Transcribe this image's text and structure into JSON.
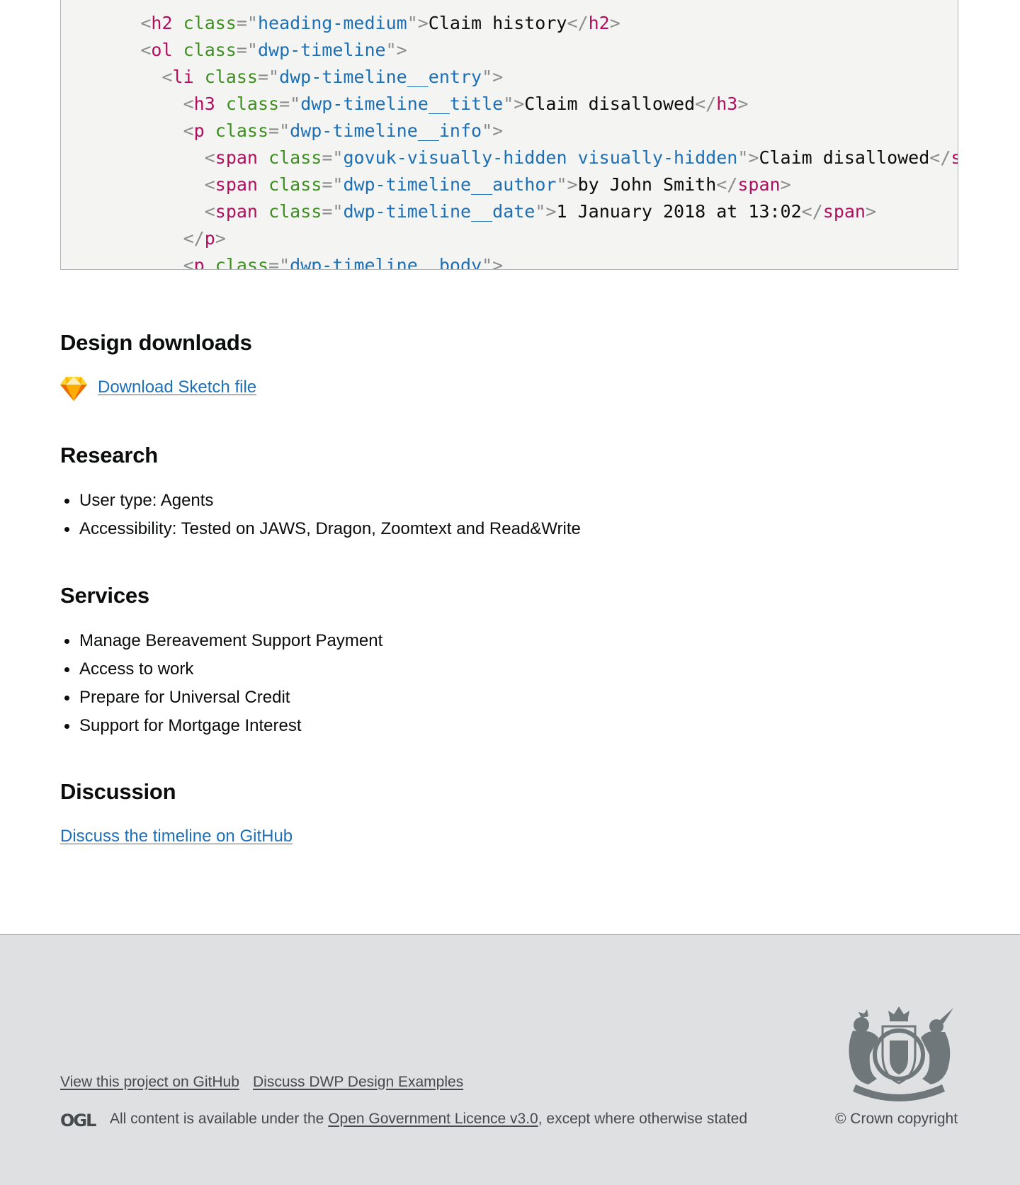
{
  "code_sample": {
    "lines": [
      {
        "indent": "      ",
        "parts": [
          [
            "p",
            "<"
          ],
          [
            "t",
            "h2"
          ],
          [
            "s",
            " "
          ],
          [
            "a",
            "class"
          ],
          [
            "p",
            "=\""
          ],
          [
            "v",
            "heading-medium"
          ],
          [
            "p",
            "\">"
          ],
          [
            "x",
            "Claim history"
          ],
          [
            "p",
            "</"
          ],
          [
            "t",
            "h2"
          ],
          [
            "p",
            ">"
          ]
        ]
      },
      {
        "indent": "      ",
        "parts": [
          [
            "p",
            "<"
          ],
          [
            "t",
            "ol"
          ],
          [
            "s",
            " "
          ],
          [
            "a",
            "class"
          ],
          [
            "p",
            "=\""
          ],
          [
            "v",
            "dwp-timeline"
          ],
          [
            "p",
            "\">"
          ]
        ]
      },
      {
        "indent": "        ",
        "parts": [
          [
            "p",
            "<"
          ],
          [
            "t",
            "li"
          ],
          [
            "s",
            " "
          ],
          [
            "a",
            "class"
          ],
          [
            "p",
            "=\""
          ],
          [
            "v",
            "dwp-timeline__entry"
          ],
          [
            "p",
            "\">"
          ]
        ]
      },
      {
        "indent": "          ",
        "parts": [
          [
            "p",
            "<"
          ],
          [
            "t",
            "h3"
          ],
          [
            "s",
            " "
          ],
          [
            "a",
            "class"
          ],
          [
            "p",
            "=\""
          ],
          [
            "v",
            "dwp-timeline__title"
          ],
          [
            "p",
            "\">"
          ],
          [
            "x",
            "Claim disallowed"
          ],
          [
            "p",
            "</"
          ],
          [
            "t",
            "h3"
          ],
          [
            "p",
            ">"
          ]
        ]
      },
      {
        "indent": "          ",
        "parts": [
          [
            "p",
            "<"
          ],
          [
            "t",
            "p"
          ],
          [
            "s",
            " "
          ],
          [
            "a",
            "class"
          ],
          [
            "p",
            "=\""
          ],
          [
            "v",
            "dwp-timeline__info"
          ],
          [
            "p",
            "\">"
          ]
        ]
      },
      {
        "indent": "            ",
        "parts": [
          [
            "p",
            "<"
          ],
          [
            "t",
            "span"
          ],
          [
            "s",
            " "
          ],
          [
            "a",
            "class"
          ],
          [
            "p",
            "=\""
          ],
          [
            "v",
            "govuk-visually-hidden visually-hidden"
          ],
          [
            "p",
            "\">"
          ],
          [
            "x",
            "Claim disallowed"
          ],
          [
            "p",
            "</"
          ],
          [
            "t",
            "span"
          ],
          [
            "p",
            ">"
          ]
        ]
      },
      {
        "indent": "            ",
        "parts": [
          [
            "p",
            "<"
          ],
          [
            "t",
            "span"
          ],
          [
            "s",
            " "
          ],
          [
            "a",
            "class"
          ],
          [
            "p",
            "=\""
          ],
          [
            "v",
            "dwp-timeline__author"
          ],
          [
            "p",
            "\">"
          ],
          [
            "x",
            "by John Smith"
          ],
          [
            "p",
            "</"
          ],
          [
            "t",
            "span"
          ],
          [
            "p",
            ">"
          ]
        ]
      },
      {
        "indent": "            ",
        "parts": [
          [
            "p",
            "<"
          ],
          [
            "t",
            "span"
          ],
          [
            "s",
            " "
          ],
          [
            "a",
            "class"
          ],
          [
            "p",
            "=\""
          ],
          [
            "v",
            "dwp-timeline__date"
          ],
          [
            "p",
            "\">"
          ],
          [
            "x",
            "1 January 2018 at 13:02"
          ],
          [
            "p",
            "</"
          ],
          [
            "t",
            "span"
          ],
          [
            "p",
            ">"
          ]
        ]
      },
      {
        "indent": "          ",
        "parts": [
          [
            "p",
            "</"
          ],
          [
            "t",
            "p"
          ],
          [
            "p",
            ">"
          ]
        ]
      },
      {
        "indent": "          ",
        "parts": [
          [
            "p",
            "<"
          ],
          [
            "t",
            "p"
          ],
          [
            "s",
            " "
          ],
          [
            "a",
            "class"
          ],
          [
            "p",
            "=\""
          ],
          [
            "v",
            "dwp-timeline__body"
          ],
          [
            "p",
            "\">"
          ]
        ]
      }
    ]
  },
  "design_downloads": {
    "heading": "Design downloads",
    "icon": "sketch-diamond-icon",
    "link": "Download Sketch file"
  },
  "research": {
    "heading": "Research",
    "items": [
      "User type: Agents",
      "Accessibility: Tested on JAWS, Dragon, Zoomtext and Read&Write"
    ]
  },
  "services": {
    "heading": "Services",
    "items": [
      "Manage Bereavement Support Payment",
      "Access to work",
      "Prepare for Universal Credit",
      "Support for Mortgage Interest"
    ]
  },
  "discussion": {
    "heading": "Discussion",
    "link": "Discuss the timeline on GitHub"
  },
  "footer": {
    "links": [
      "View this project on GitHub",
      "Discuss DWP Design Examples"
    ],
    "ogl_logo": "OGL",
    "licence_prefix": "All content is available under the ",
    "licence_link": "Open Government Licence v3.0",
    "licence_suffix": ", except where otherwise stated",
    "copyright": "© Crown copyright",
    "crest_icon": "royal-coat-of-arms-icon"
  },
  "colors": {
    "link": "#1d70b8",
    "footer_bg": "#dee0e2",
    "code_bg": "#f4f4f2"
  }
}
